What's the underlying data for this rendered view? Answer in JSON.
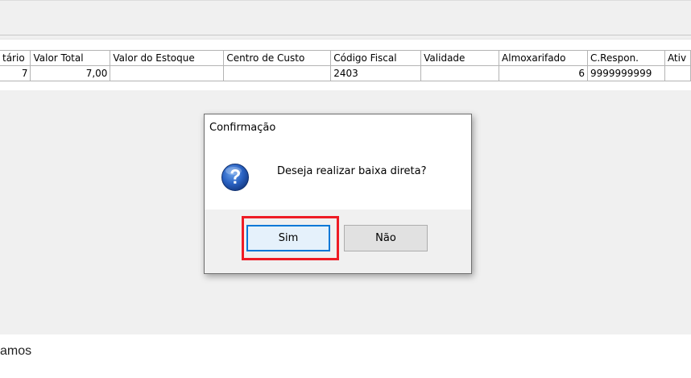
{
  "grid": {
    "columns": [
      "tário",
      "Valor Total",
      "Valor do Estoque",
      "Centro de Custo",
      "Código Fiscal",
      "Validade",
      "Almoxarifado",
      "C.Respon.",
      "Ativ"
    ],
    "row": [
      "7",
      "7,00",
      "",
      "",
      "2403",
      "",
      "6",
      "9999999999",
      ""
    ]
  },
  "dialog": {
    "title": "Confirmação",
    "message": "Deseja realizar baixa direta?",
    "icon": "question-icon",
    "yes_label": "Sim",
    "no_label": "Não"
  },
  "caption": "amos",
  "colors": {
    "highlight": "#ee1c25",
    "focus_border": "#0078d7",
    "icon_blue": "#1e56b0"
  }
}
